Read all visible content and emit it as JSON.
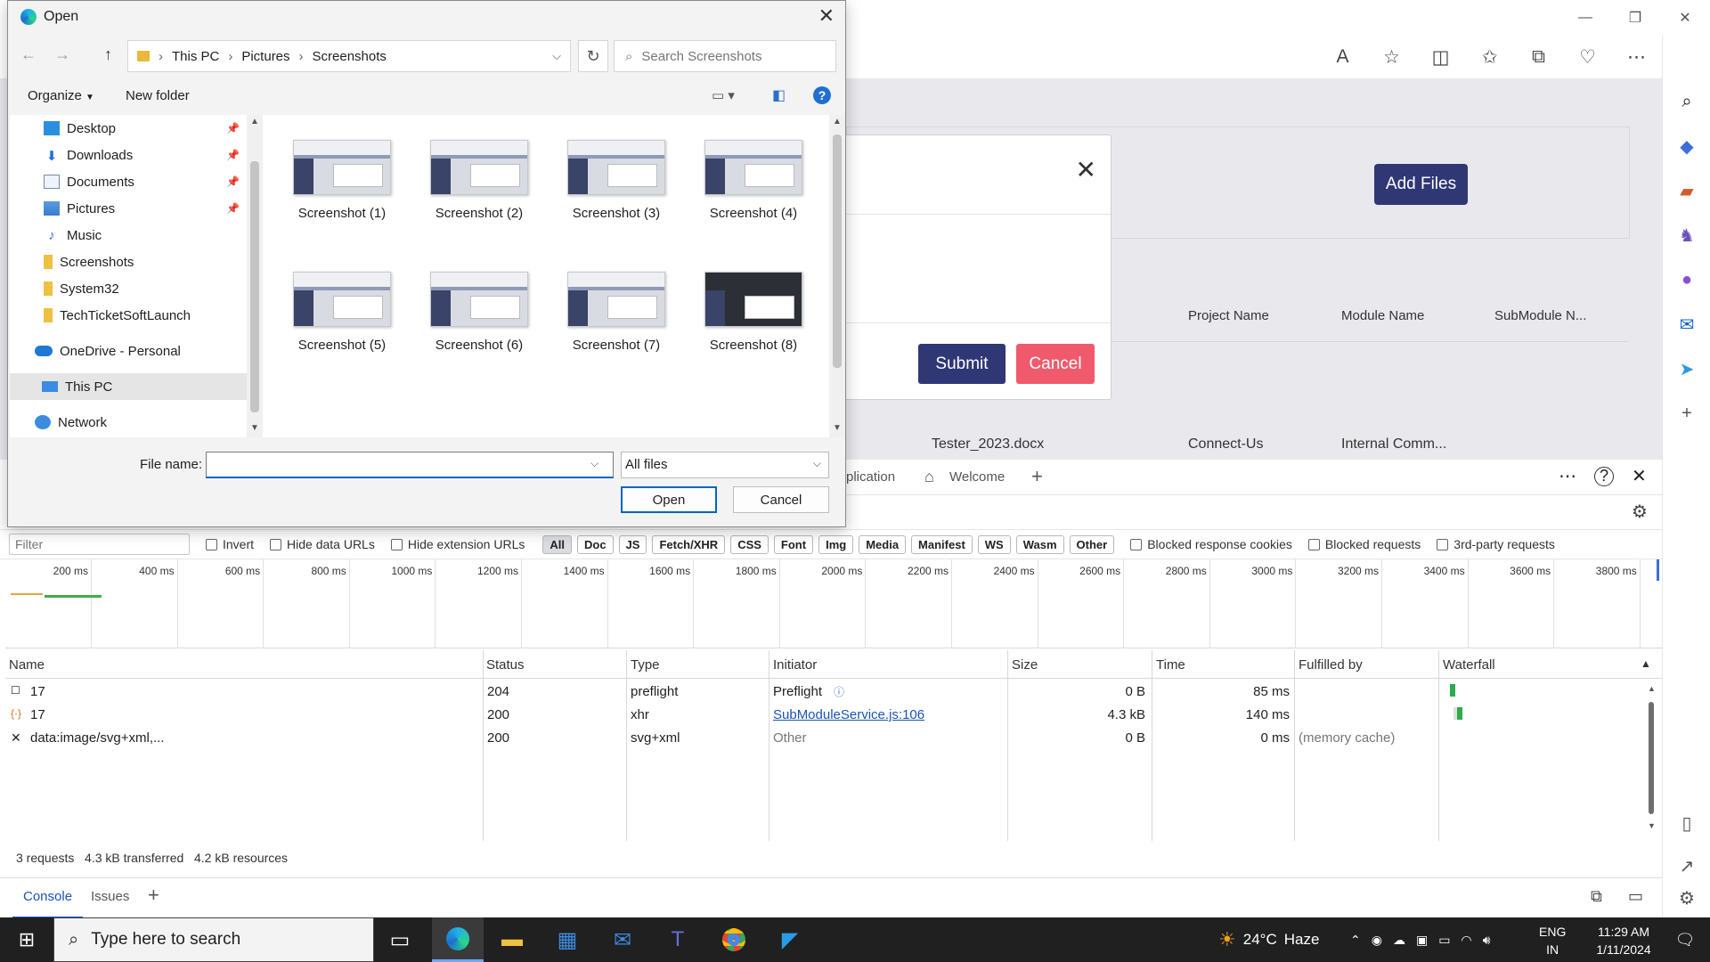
{
  "dialog": {
    "title": "Open",
    "breadcrumb": [
      "This PC",
      "Pictures",
      "Screenshots"
    ],
    "search_placeholder": "Search Screenshots",
    "organize_label": "Organize",
    "new_folder_label": "New folder",
    "nav_items": [
      {
        "label": "Desktop",
        "icon": "desktop-icon",
        "pinned": true
      },
      {
        "label": "Downloads",
        "icon": "downloads-icon",
        "pinned": true
      },
      {
        "label": "Documents",
        "icon": "documents-icon",
        "pinned": true
      },
      {
        "label": "Pictures",
        "icon": "pictures-icon",
        "pinned": true
      },
      {
        "label": "Music",
        "icon": "music-icon",
        "pinned": false
      },
      {
        "label": "Screenshots",
        "icon": "folder-icon",
        "pinned": false
      },
      {
        "label": "System32",
        "icon": "folder-icon",
        "pinned": false
      },
      {
        "label": "TechTicketSoftLaunch",
        "icon": "folder-icon",
        "pinned": false
      },
      {
        "label": "OneDrive - Personal",
        "icon": "onedrive-icon",
        "pinned": false
      },
      {
        "label": "This PC",
        "icon": "this-pc-icon",
        "pinned": false,
        "selected": true
      },
      {
        "label": "Network",
        "icon": "network-icon",
        "pinned": false
      }
    ],
    "files": [
      "Screenshot (1)",
      "Screenshot (2)",
      "Screenshot (3)",
      "Screenshot (4)",
      "Screenshot (5)",
      "Screenshot (6)",
      "Screenshot (7)",
      "Screenshot (8)"
    ],
    "file_name_label": "File name:",
    "file_name_value": "",
    "file_type": "All files",
    "open_label": "Open",
    "cancel_label": "Cancel"
  },
  "webpage": {
    "add_files_label": "Add Files",
    "submit_label": "Submit",
    "cancel_label": "Cancel",
    "columns": [
      "Project Name",
      "Module Name",
      "SubModule N..."
    ],
    "row": {
      "file": "Tester_2023.docx",
      "project": "Connect-Us",
      "module": "Internal Comm..."
    }
  },
  "devtools": {
    "tabs_partial": [
      "plication",
      "Welcome"
    ],
    "filter_placeholder": "Filter",
    "checkboxes": [
      "Invert",
      "Hide data URLs",
      "Hide extension URLs"
    ],
    "type_filters": [
      "All",
      "Doc",
      "JS",
      "Fetch/XHR",
      "CSS",
      "Font",
      "Img",
      "Media",
      "Manifest",
      "WS",
      "Wasm",
      "Other"
    ],
    "extra_checkboxes": [
      "Blocked response cookies",
      "Blocked requests",
      "3rd-party requests"
    ],
    "timeline_ticks": [
      "200 ms",
      "400 ms",
      "600 ms",
      "800 ms",
      "1000 ms",
      "1200 ms",
      "1400 ms",
      "1600 ms",
      "1800 ms",
      "2000 ms",
      "2200 ms",
      "2400 ms",
      "2600 ms",
      "2800 ms",
      "3000 ms",
      "3200 ms",
      "3400 ms",
      "3600 ms",
      "3800 ms"
    ],
    "columns": [
      "Name",
      "Status",
      "Type",
      "Initiator",
      "Size",
      "Time",
      "Fulfilled by",
      "Waterfall"
    ],
    "requests": [
      {
        "name": "17",
        "status": "204",
        "type": "preflight",
        "initiator": "Preflight",
        "size": "0 B",
        "time": "85 ms",
        "fulfilled": ""
      },
      {
        "name": "17",
        "status": "200",
        "type": "xhr",
        "initiator": "SubModuleService.js:106",
        "size": "4.3 kB",
        "time": "140 ms",
        "fulfilled": ""
      },
      {
        "name": "data:image/svg+xml,...",
        "status": "200",
        "type": "svg+xml",
        "initiator": "Other",
        "size": "0 B",
        "time": "0 ms",
        "fulfilled": "(memory cache)"
      }
    ],
    "summary": [
      "3 requests",
      "4.3 kB transferred",
      "4.2 kB resources"
    ],
    "drawer_tabs": [
      "Console",
      "Issues"
    ]
  },
  "taskbar": {
    "search_placeholder": "Type here to search",
    "weather_temp": "24°C",
    "weather_desc": "Haze",
    "lang_top": "ENG",
    "lang_bottom": "IN",
    "time": "11:29 AM",
    "date": "1/11/2024"
  }
}
